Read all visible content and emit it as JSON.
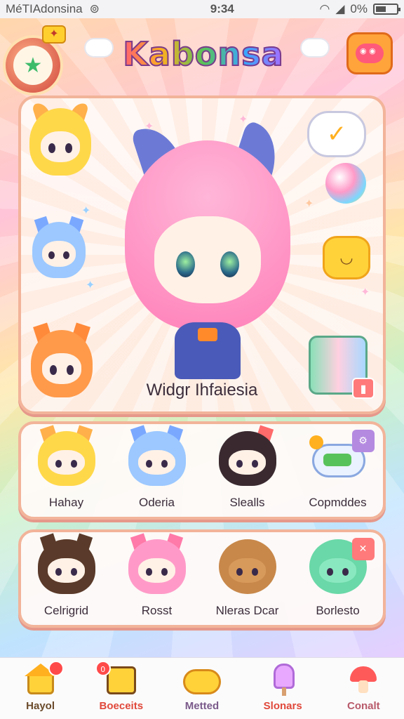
{
  "status_bar": {
    "carrier": "MéTIAdonsina",
    "time": "9:34",
    "battery": "0%",
    "battery_suffix": "%"
  },
  "header": {
    "title": "Kabonsa"
  },
  "hero": {
    "label": "Widgr Ihfaiesia"
  },
  "characters_row1": [
    {
      "name": "Hahay",
      "hair": "#ffd84a",
      "body": "#ff9a3a",
      "ear": "#ffb04a"
    },
    {
      "name": "Oderia",
      "hair": "#9cc8ff",
      "body": "#4a9ad8",
      "ear": "#7aa8ff"
    },
    {
      "name": "Slealls",
      "hair": "#3a2a30",
      "body": "#7a4ab8",
      "ear": "#ff6a6a"
    },
    {
      "name": "Copmddes",
      "hair": "#d8e8ff",
      "body": "#58c25a",
      "ear": "#ffb04a"
    }
  ],
  "characters_row2": [
    {
      "name": "Celrigrid",
      "hair": "#5a3a2a",
      "body": "#3a6ab8",
      "ear": "#5a3a2a"
    },
    {
      "name": "Rosst",
      "hair": "#ff9ac8",
      "body": "#ff6a3a",
      "ear": "#ff7aa8"
    },
    {
      "name": "Nleras Dcar",
      "hair": "#c8884a",
      "body": "#c8884a",
      "ear": "#a86a3a"
    },
    {
      "name": "Borlesto",
      "hair": "#6ad8a8",
      "body": "#48b888",
      "ear": "#6ad8a8"
    }
  ],
  "tabs": [
    {
      "label": "Hayol",
      "color": "#6a4a2a",
      "badge": "",
      "icon": "house-icon"
    },
    {
      "label": "Boeceits",
      "color": "#e0483a",
      "badge": "0",
      "icon": "book-icon"
    },
    {
      "label": "Metted",
      "color": "#7a5a8a",
      "badge": "",
      "icon": "smile-blob-icon"
    },
    {
      "label": "Slonars",
      "color": "#e0483a",
      "badge": "",
      "icon": "popsicle-icon"
    },
    {
      "label": "Conalt",
      "color": "#b85a6a",
      "badge": "",
      "icon": "mushroom-icon"
    }
  ],
  "colors": {
    "panel_border": "#f2b49a",
    "title_outline": "#7a3b8c"
  }
}
